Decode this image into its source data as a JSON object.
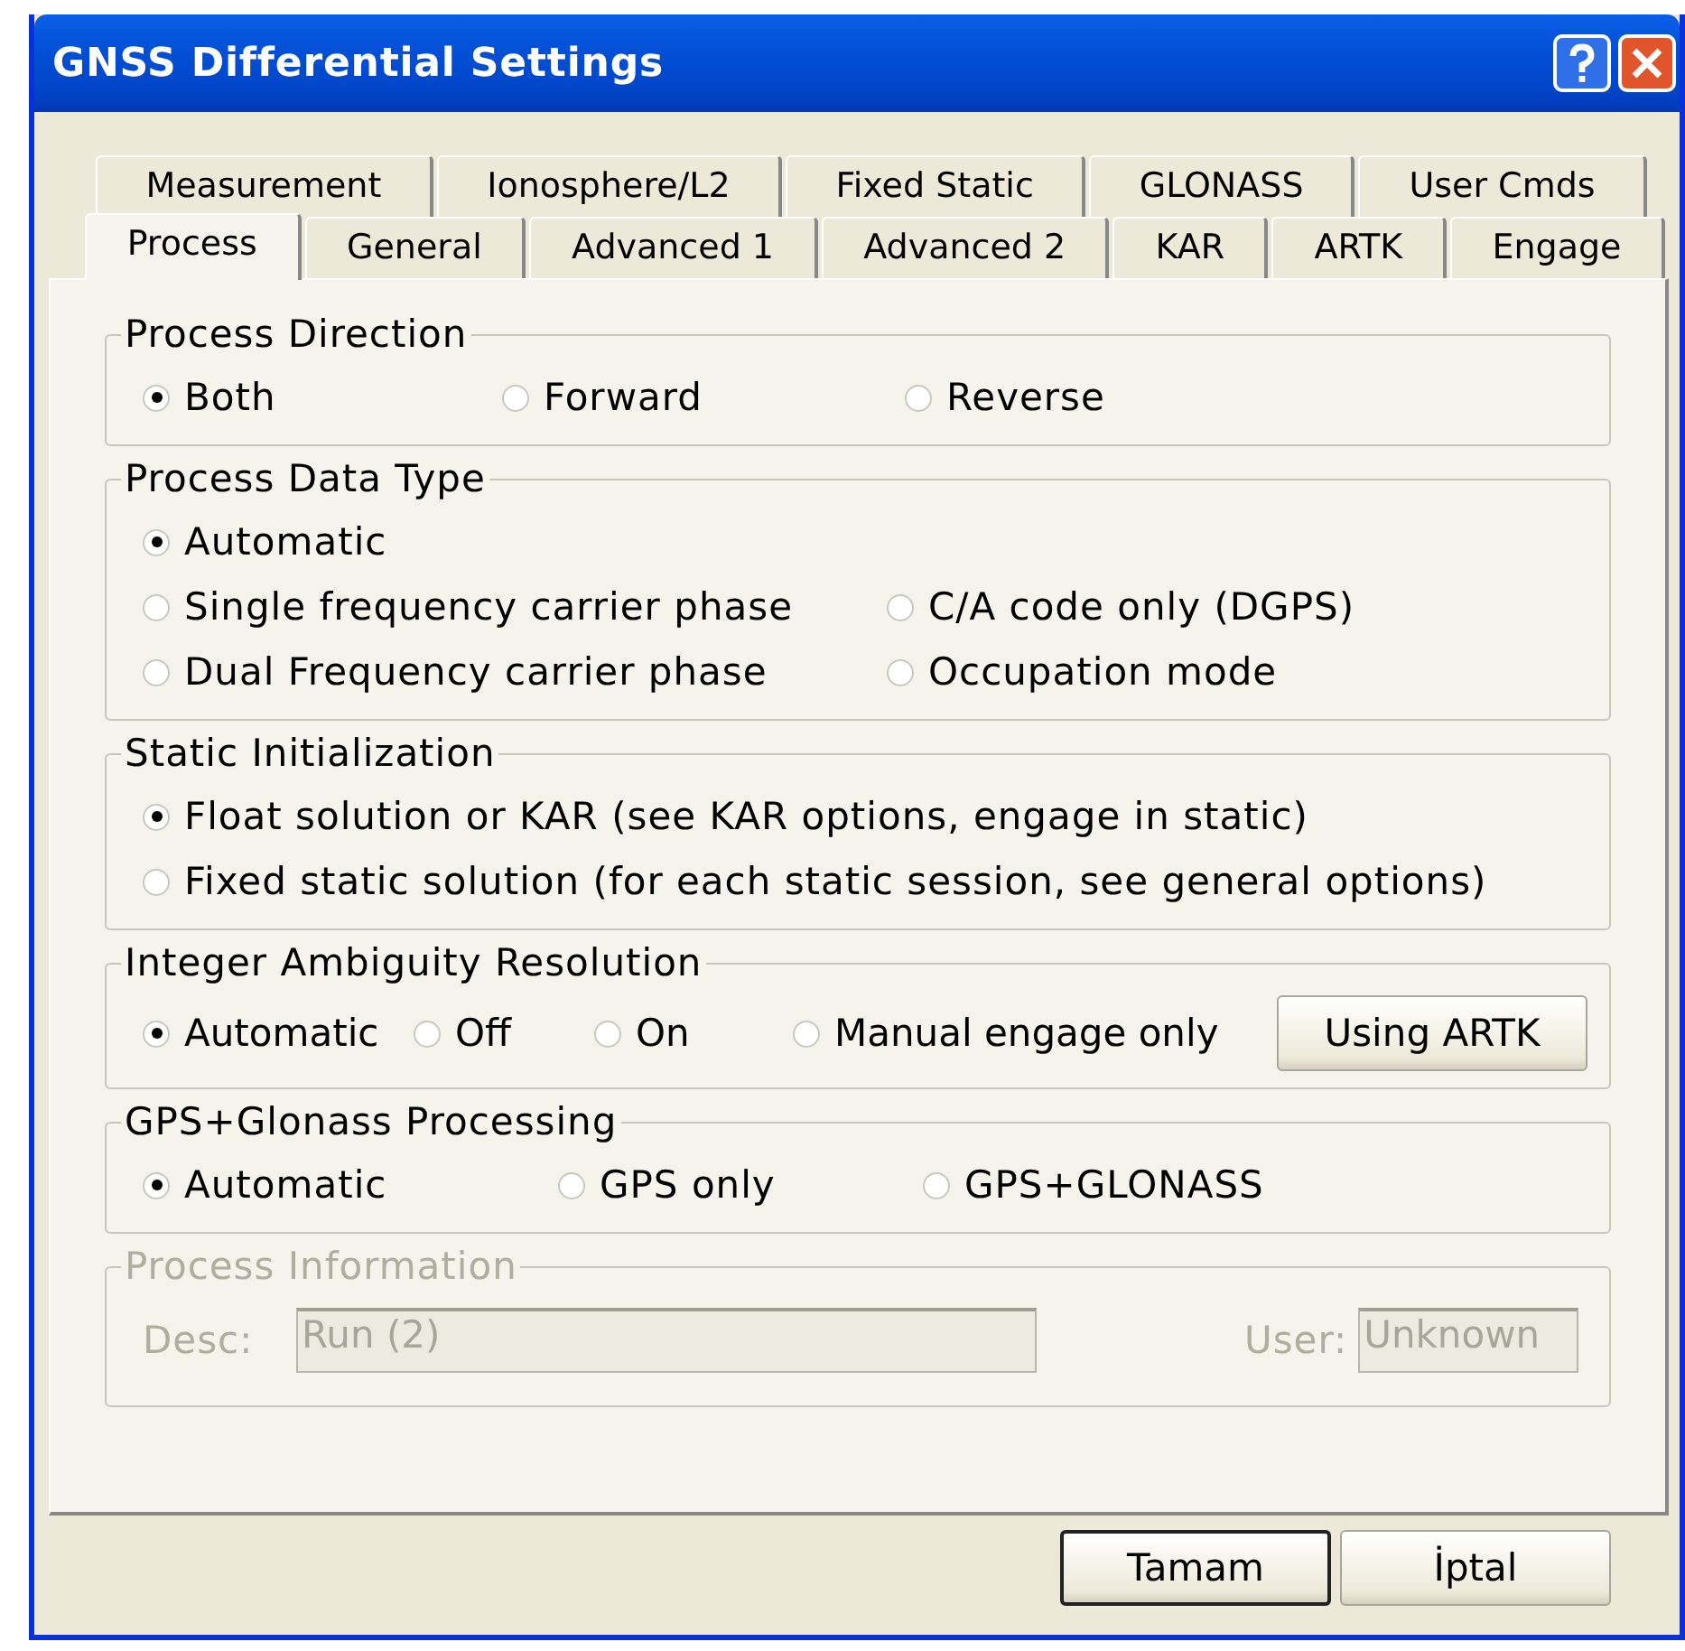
{
  "window": {
    "title": "GNSS Differential Settings"
  },
  "tabs": {
    "back_row": [
      {
        "label": "Measurement",
        "selected": false
      },
      {
        "label": "Ionosphere/L2",
        "selected": false
      },
      {
        "label": "Fixed Static",
        "selected": false
      },
      {
        "label": "GLONASS",
        "selected": false
      },
      {
        "label": "User Cmds",
        "selected": false
      }
    ],
    "front_row": [
      {
        "label": "Process",
        "selected": true
      },
      {
        "label": "General",
        "selected": false
      },
      {
        "label": "Advanced 1",
        "selected": false
      },
      {
        "label": "Advanced 2",
        "selected": false
      },
      {
        "label": "KAR",
        "selected": false
      },
      {
        "label": "ARTK",
        "selected": false
      },
      {
        "label": "Engage",
        "selected": false
      }
    ]
  },
  "groups": [
    {
      "kind": "radios",
      "title": "Process Direction",
      "rows": [
        [
          {
            "kind": "radio",
            "label": "Both",
            "selected": true
          },
          {
            "kind": "radio",
            "label": "Forward",
            "selected": false
          },
          {
            "kind": "radio",
            "label": "Reverse",
            "selected": false
          }
        ]
      ]
    },
    {
      "kind": "radios",
      "title": "Process Data Type",
      "rows": [
        [
          {
            "kind": "radio",
            "label": "Automatic",
            "selected": true
          }
        ],
        [
          {
            "kind": "radio",
            "label": "Single frequency carrier phase",
            "selected": false
          },
          {
            "kind": "radio",
            "label": "C/A code only (DGPS)",
            "selected": false
          }
        ],
        [
          {
            "kind": "radio",
            "label": "Dual Frequency carrier phase",
            "selected": false
          },
          {
            "kind": "radio",
            "label": "Occupation mode",
            "selected": false
          }
        ]
      ]
    },
    {
      "kind": "radios",
      "title": "Static Initialization",
      "rows": [
        [
          {
            "kind": "radio",
            "label": "Float solution or KAR (see KAR options, engage in static)",
            "selected": true
          }
        ],
        [
          {
            "kind": "radio",
            "label": "Fixed static solution (for each static session, see general options)",
            "selected": false
          }
        ]
      ]
    },
    {
      "kind": "radios",
      "title": "Integer Ambiguity Resolution",
      "rows": [
        [
          {
            "kind": "radio",
            "label": "Automatic",
            "selected": true
          },
          {
            "kind": "radio",
            "label": "Off",
            "selected": false
          },
          {
            "kind": "radio",
            "label": "On",
            "selected": false
          },
          {
            "kind": "radio",
            "label": "Manual engage only",
            "selected": false
          },
          {
            "kind": "button",
            "label": "Using ARTK"
          }
        ]
      ]
    },
    {
      "kind": "radios",
      "title": "GPS+Glonass Processing",
      "rows": [
        [
          {
            "kind": "radio",
            "label": "Automatic",
            "selected": true
          },
          {
            "kind": "radio",
            "label": "GPS only",
            "selected": false
          },
          {
            "kind": "radio",
            "label": "GPS+GLONASS",
            "selected": false
          }
        ]
      ]
    },
    {
      "kind": "info",
      "title": "Process Information",
      "disabled": true,
      "fields": [
        {
          "label": "Desc:",
          "value": "Run (2)"
        },
        {
          "label": "User:",
          "value": "Unknown"
        }
      ]
    }
  ],
  "buttons": [
    {
      "label": "Tamam",
      "default": true
    },
    {
      "label": "İptal",
      "default": false
    }
  ]
}
